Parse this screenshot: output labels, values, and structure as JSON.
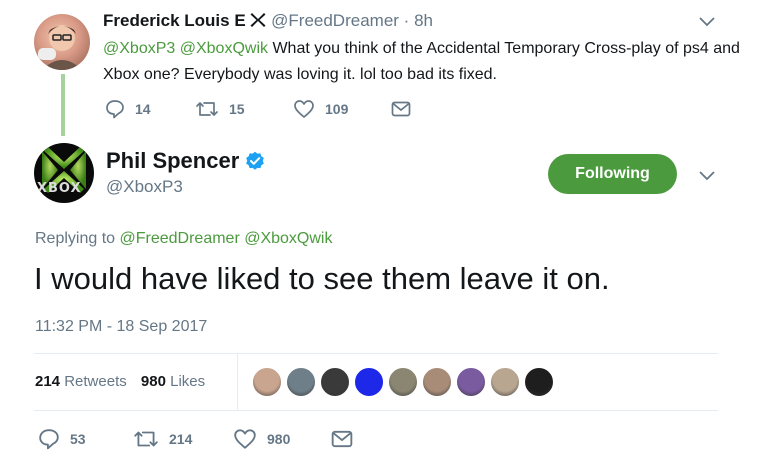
{
  "reply_tweet": {
    "author_name": "Frederick Louis E",
    "author_handle": "@FreedDreamer",
    "separator": "·",
    "time": "8h",
    "mentions": "@XboxP3 @XboxQwik",
    "text": " What you think of the Accidental Temporary Cross-play of ps4 and Xbox one? Everybody was loving it. lol too bad its fixed.",
    "reply_count": "14",
    "retweet_count": "15",
    "like_count": "109"
  },
  "main_tweet": {
    "author_name": "Phil Spencer",
    "author_handle": "@XboxP3",
    "avatar_text": "XBOX",
    "follow_label": "Following",
    "replying_prefix": "Replying to ",
    "replying_to": "@FreedDreamer @XboxQwik",
    "text": "I would have liked to see them leave it on.",
    "timestamp": "11:32 PM - 18 Sep 2017",
    "retweets_value": "214",
    "retweets_label": "Retweets",
    "likes_value": "980",
    "likes_label": "Likes",
    "reply_count": "53",
    "retweet_count": "214",
    "like_count": "980"
  },
  "colors": {
    "accent": "#4b9b3e",
    "verified": "#1da1f2",
    "text": "#14171a",
    "muted": "#657786"
  },
  "liker_colors": [
    "#c9a48e",
    "#6f7f8a",
    "#3a3a3a",
    "#1d28e8",
    "#8b8672",
    "#a88c78",
    "#7a5ba0",
    "#b8a690",
    "#1e1e1e"
  ]
}
